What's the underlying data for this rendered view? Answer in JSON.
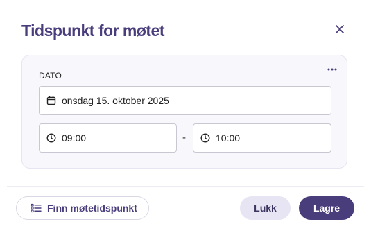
{
  "dialog": {
    "title": "Tidspunkt for møtet",
    "close_icon": "close-icon"
  },
  "card": {
    "more_icon": "more-horizontal-icon",
    "date_label": "DATO",
    "date_value": "onsdag 15. oktober 2025",
    "date_icon": "calendar-icon",
    "start_time": "09:00",
    "end_time": "10:00",
    "time_icon": "clock-icon",
    "separator": "-"
  },
  "footer": {
    "find_button_label": "Finn møtetidspunkt",
    "find_button_icon": "list-settings-icon",
    "close_button_label": "Lukk",
    "save_button_label": "Lagre"
  },
  "colors": {
    "accent": "#4a3d7c",
    "secondary_button_bg": "#e7e4f3",
    "card_bg": "#f7f7fc"
  }
}
